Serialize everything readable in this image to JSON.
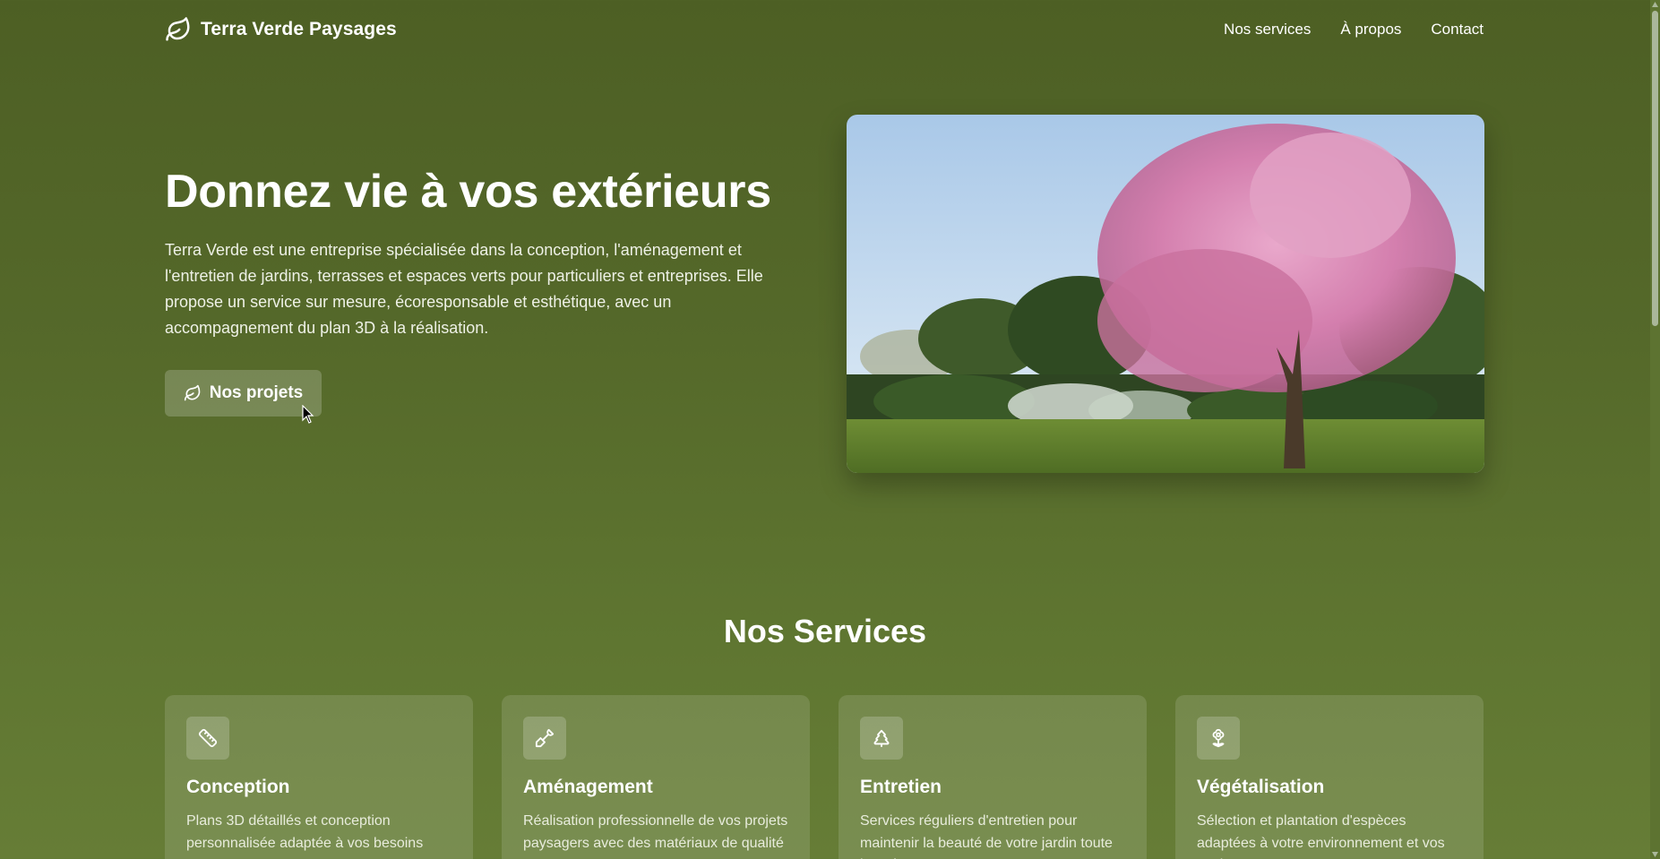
{
  "header": {
    "brand_name": "Terra Verde Paysages",
    "brand_icon": "leaf-icon",
    "nav": [
      {
        "label": "Nos services"
      },
      {
        "label": "À propos"
      },
      {
        "label": "Contact"
      }
    ]
  },
  "hero": {
    "title": "Donnez vie à vos extérieurs",
    "description": "Terra Verde est une entreprise spécialisée dans la conception, l'aménagement et l'entretien de jardins, terrasses et espaces verts pour particuliers et entreprises. Elle propose un service sur mesure, écoresponsable et esthétique, avec un accompagnement du plan 3D à la réalisation.",
    "button_label": "Nos projets",
    "button_icon": "leaf-icon",
    "image": "garden-photo-blossoming-tree"
  },
  "services": {
    "title": "Nos Services",
    "cards": [
      {
        "icon": "ruler-icon",
        "title": "Conception",
        "description": "Plans 3D détaillés et conception personnalisée adaptée à vos besoins"
      },
      {
        "icon": "shovel-icon",
        "title": "Aménagement",
        "description": "Réalisation professionnelle de vos projets paysagers avec des matériaux de qualité"
      },
      {
        "icon": "tree-icon",
        "title": "Entretien",
        "description": "Services réguliers d'entretien pour maintenir la beauté de votre jardin toute l'année"
      },
      {
        "icon": "flower-icon",
        "title": "Végétalisation",
        "description": "Sélection et plantation d'espèces adaptées à votre environnement et vos envies"
      }
    ]
  },
  "colors": {
    "background_top": "#4d5f24",
    "background_bottom": "#667d36",
    "text": "#ffffff"
  }
}
